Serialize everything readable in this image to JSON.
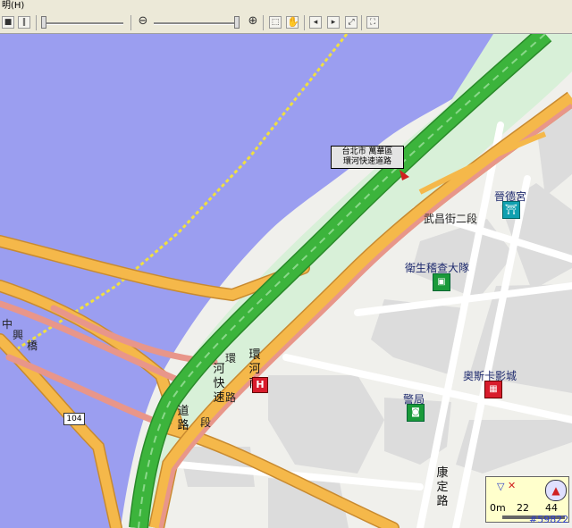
{
  "menubar": {
    "item": "明(H)"
  },
  "map": {
    "tooltip": {
      "line1": "台北市 萬華區",
      "line2": "環河快速道路"
    },
    "road_shield": "104",
    "labels": {
      "wuchang_st": "武昌街二段",
      "zhong": "中",
      "xing": "興",
      "qiao": "橋",
      "kangding": [
        "康",
        "定",
        "路"
      ],
      "huanhe_s_road_col1": [
        "環",
        "河",
        "南"
      ],
      "huanhe_expressway_col": [
        "河",
        "快",
        "速"
      ],
      "dao_lu": [
        "道",
        "路"
      ],
      "huan": "環",
      "lu": "路",
      "duan": "段"
    },
    "pois": [
      {
        "name": "晉德宮",
        "icon": "temple-icon",
        "color": "#10a0b0"
      },
      {
        "name": "衛生稽查大隊",
        "icon": "office-icon",
        "color": "#1a9a3a"
      },
      {
        "name": "奧斯卡影城",
        "icon": "cinema-icon",
        "color": "#d81c2c"
      },
      {
        "name": "警局",
        "icon": "police-icon",
        "color": "#1a9a3a"
      }
    ],
    "hospital_icon": "hospital-icon",
    "scale": {
      "zero": "0m",
      "mid": "22",
      "max": "44"
    },
    "watermark": "#59822",
    "colors": {
      "water": "#9b9ef0",
      "land": "#f0f0ec",
      "block": "#dcdcdc",
      "park": "#d8f0d8",
      "expressway": "#3cb43c",
      "major_road": "#f5b84a",
      "ramp": "#e8968a"
    }
  }
}
